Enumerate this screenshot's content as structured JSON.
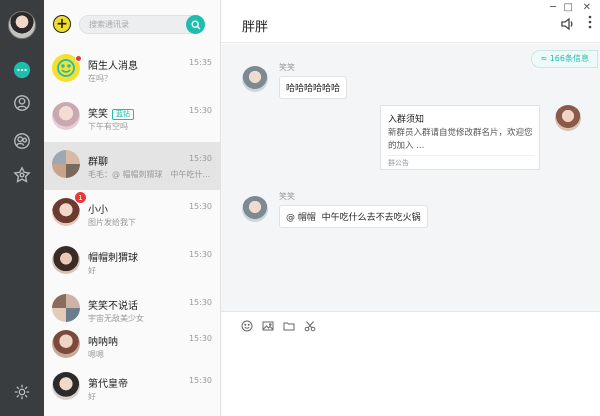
{
  "sidebar": {
    "icons": [
      "chat-icon",
      "contacts-icon",
      "group-icon",
      "settings-flower-icon",
      "gear-icon"
    ]
  },
  "contacts": {
    "add_label": "+",
    "search_placeholder": "搜索通讯录",
    "items": [
      {
        "name": "陌生人消息",
        "msg": "在吗？",
        "time": "15:35",
        "tag": ""
      },
      {
        "name": "笑笑",
        "msg": "下午有空吗",
        "time": "15:30",
        "tag": "蓝钻"
      },
      {
        "name": "群聊",
        "msg": "毛毛：@ 帽帽刺猬球　中午吃什...",
        "time": "15:30",
        "tag": ""
      },
      {
        "name": "小小",
        "msg": "图片发给我下",
        "time": "15:30",
        "tag": "",
        "badge": "1"
      },
      {
        "name": "帽帽刺猬球",
        "msg": "好",
        "time": "15:30",
        "tag": ""
      },
      {
        "name": "笑笑不说话",
        "msg": "宇宙无敌美少女",
        "time": "15:30",
        "tag": ""
      },
      {
        "name": "呐呐呐",
        "msg": "嗯嗯",
        "time": "15:30",
        "tag": ""
      },
      {
        "name": "第代皇帝",
        "msg": "好",
        "time": "15:30",
        "tag": ""
      }
    ]
  },
  "chat": {
    "title": "胖胖",
    "window_controls": [
      "─",
      "□",
      "✕"
    ],
    "unread": "166条信息",
    "messages": [
      {
        "sender": "笑笑",
        "text": "哈哈哈哈哈哈"
      },
      {
        "sender": "",
        "notice_title": "入群须知",
        "notice_body": "新群员入群请自觉修改群名片，欢迎您的加入 ...",
        "notice_footer": "群公告"
      },
      {
        "sender": "笑笑",
        "mention": "@ 帽帽",
        "text": "中午吃什么去不去吃火锅"
      }
    ]
  },
  "colors": {
    "accent": "#1fbdae",
    "rail": "#3a3d40",
    "badge": "#e23b3b"
  }
}
